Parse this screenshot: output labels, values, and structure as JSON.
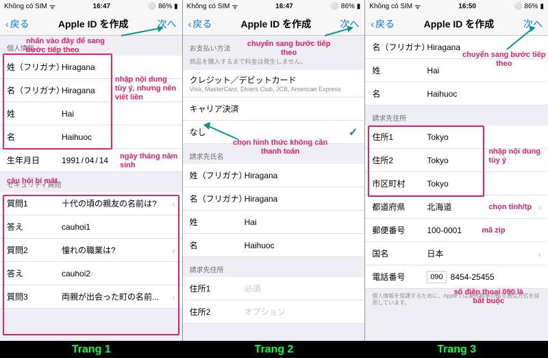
{
  "status": {
    "carrier": "Không có SIM",
    "wifi": "⌃",
    "battery": "86%",
    "batt_icon": "■"
  },
  "times": {
    "p1": "16:47",
    "p2": "16:47",
    "p3": "16:50"
  },
  "nav": {
    "back": "戻る",
    "title": "Apple ID を作成",
    "next": "次へ"
  },
  "labels": {
    "p1": "Trang 1",
    "p2": "Trang 2",
    "p3": "Trang 3"
  },
  "p1": {
    "sec_personal": "個人情報",
    "sei_furi_lbl": "姓（フリガナ）",
    "sei_furi_val": "Hiragana",
    "mei_furi_lbl": "名（フリガナ）",
    "mei_furi_val": "Hiragana",
    "sei_lbl": "姓",
    "sei_val": "Hai",
    "mei_lbl": "名",
    "mei_val": "Haihuoc",
    "dob_lbl": "生年月日",
    "dob_y": "1991",
    "dob_m": "04",
    "dob_d": "14",
    "sec_secq": "セキュリティ質問",
    "q1_lbl": "質問1",
    "q1_val": "十代の頃の親友の名前は?",
    "a1_lbl": "答え",
    "a1_val": "cauhoi1",
    "q2_lbl": "質問2",
    "q2_val": "憧れの職業は?",
    "a2_lbl": "答え",
    "a2_val": "cauhoi2",
    "q3_lbl": "質問3",
    "q3_val": "両親が出会った町の名前...",
    "ann_next": "nhấn vào đây để sang bước tiếp theo",
    "ann_name": "nhập nội dung tùy ý, nhưng nên viết liền",
    "ann_dob": "ngày tháng năm sinh",
    "ann_secq": "câu hỏi bí mật"
  },
  "p2": {
    "sec_pay": "お支払い方法",
    "sec_pay_sub": "商品を購入するまで料金は発生しません。",
    "card_lbl": "クレジット／デビットカード",
    "card_sub": "Visa, MasterCard, Diners Club, JCB, American Express",
    "carrier": "キャリア決済",
    "none": "なし",
    "sec_bill": "請求先氏名",
    "sei_furi_lbl": "姓（フリガナ）",
    "sei_furi_val": "Hiragana",
    "mei_furi_lbl": "名（フリガナ）",
    "mei_furi_val": "Hiragana",
    "sei_lbl": "姓",
    "sei_val": "Hai",
    "mei_lbl": "名",
    "mei_val": "Haihuoc",
    "sec_addr": "請求先住所",
    "addr1_lbl": "住所1",
    "addr1_val": "必須",
    "addr2_lbl": "住所2",
    "addr2_val": "オプション",
    "ann_next": "chuyển sang bước tiếp theo",
    "ann_none": "chọn hình thức không cần thanh toán"
  },
  "p3": {
    "mei_furi_lbl": "名（フリガナ）",
    "mei_furi_val": "Hiragana",
    "sei_lbl": "姓",
    "sei_val": "Hai",
    "mei_lbl": "名",
    "mei_val": "Haihuoc",
    "sec_addr": "請求先住所",
    "addr1_lbl": "住所1",
    "addr1_val": "Tokyo",
    "addr2_lbl": "住所2",
    "addr2_val": "Tokyo",
    "city_lbl": "市区町村",
    "city_val": "Tokyo",
    "pref_lbl": "都道府県",
    "pref_val": "北海道",
    "zip_lbl": "郵便番号",
    "zip_val": "100-0001",
    "country_lbl": "国名",
    "country_val": "日本",
    "phone_lbl": "電話番号",
    "phone_prefix": "090",
    "phone_val": "8454-25455",
    "footer": "個人情報を保護するために、Appleでは業界標準の暗号通信方式を採用しています。",
    "ann_next": "chuyển sang bước tiếp theo",
    "ann_addr": "nhập nội dung tùy ý",
    "ann_pref": "chọn tỉnh/tp",
    "ann_zip": "mã zip",
    "ann_phone": "số điện thoại 090 là bắt buộc"
  }
}
